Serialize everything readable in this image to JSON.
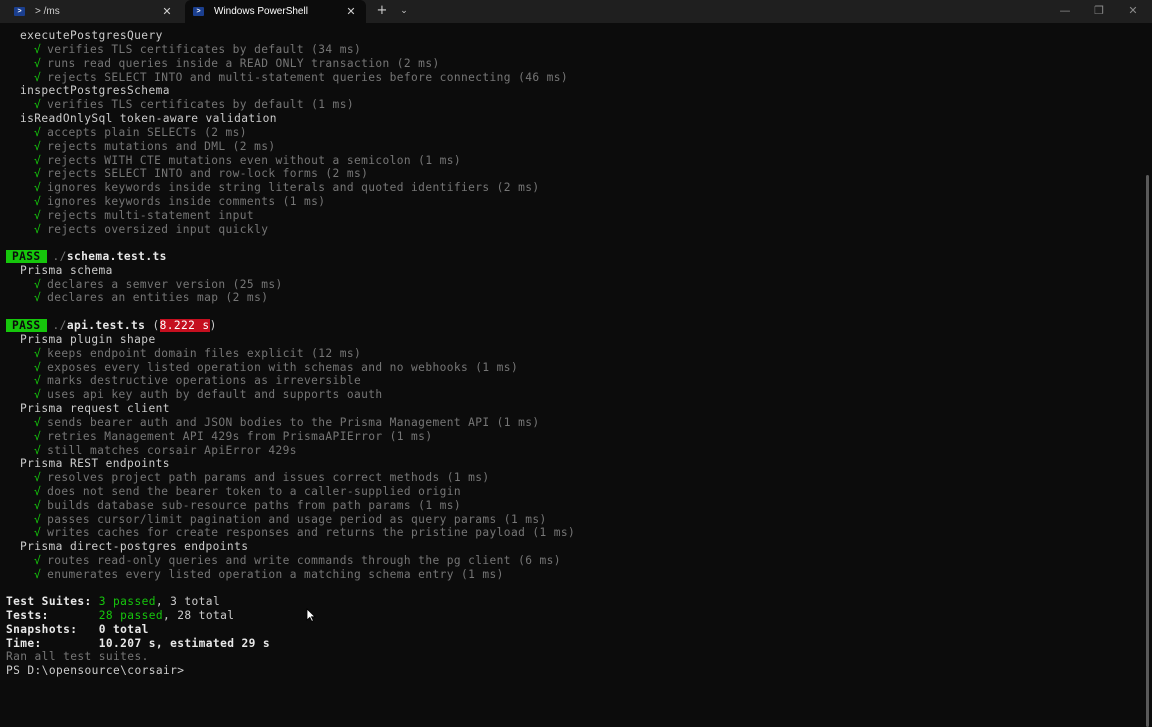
{
  "tabs": [
    {
      "label": "> /ms",
      "icon": "powershell-icon",
      "active": false
    },
    {
      "label": "Windows PowerShell",
      "icon": "powershell-icon",
      "active": true
    }
  ],
  "titlebar": {
    "new_tab": "+",
    "dropdown": "⌄",
    "minimize": "—",
    "maximize": "❐",
    "close": "✕",
    "tab_close": "✕"
  },
  "terminal": {
    "check": "√",
    "suite1": {
      "g1": "executePostgresQuery",
      "g1_items": [
        "verifies TLS certificates by default (34 ms)",
        "runs read queries inside a READ ONLY transaction (2 ms)",
        "rejects SELECT INTO and multi-statement queries before connecting (46 ms)"
      ],
      "g2": "inspectPostgresSchema",
      "g2_items": [
        "verifies TLS certificates by default (1 ms)"
      ],
      "g3": "isReadOnlySql token-aware validation",
      "g3_items": [
        "accepts plain SELECTs (2 ms)",
        "rejects mutations and DML (2 ms)",
        "rejects WITH CTE mutations even without a semicolon (1 ms)",
        "rejects SELECT INTO and row-lock forms (2 ms)",
        "ignores keywords inside string literals and quoted identifiers (2 ms)",
        "ignores keywords inside comments (1 ms)",
        "rejects multi-statement input",
        "rejects oversized input quickly"
      ]
    },
    "suite2": {
      "badge": "PASS",
      "dir": "./",
      "file": "schema.test.ts",
      "g1": "Prisma schema",
      "g1_items": [
        "declares a semver version (25 ms)",
        "declares an entities map (2 ms)"
      ]
    },
    "suite3": {
      "badge": "PASS",
      "dir": "./",
      "file": "api.test.ts",
      "paren_open": " (",
      "duration": "8.222 s",
      "paren_close": ")",
      "g1": "Prisma plugin shape",
      "g1_items": [
        "keeps endpoint domain files explicit (12 ms)",
        "exposes every listed operation with schemas and no webhooks (1 ms)",
        "marks destructive operations as irreversible",
        "uses api key auth by default and supports oauth"
      ],
      "g2": "Prisma request client",
      "g2_items": [
        "sends bearer auth and JSON bodies to the Prisma Management API (1 ms)",
        "retries Management API 429s from PrismaAPIError (1 ms)",
        "still matches corsair ApiError 429s"
      ],
      "g3": "Prisma REST endpoints",
      "g3_items": [
        "resolves project path params and issues correct methods (1 ms)",
        "does not send the bearer token to a caller-supplied origin",
        "builds database sub-resource paths from path params (1 ms)",
        "passes cursor/limit pagination and usage period as query params (1 ms)",
        "writes caches for create responses and returns the pristine payload (1 ms)"
      ],
      "g4": "Prisma direct-postgres endpoints",
      "g4_items": [
        "routes read-only queries and write commands through the pg client (6 ms)",
        "enumerates every listed operation a matching schema entry (1 ms)"
      ]
    },
    "summary": {
      "suites_label": "Test Suites: ",
      "suites_passed": "3 passed",
      "suites_rest": ", 3 total",
      "tests_label": "Tests:       ",
      "tests_passed": "28 passed",
      "tests_rest": ", 28 total",
      "snapshots": "Snapshots:   0 total",
      "time": "Time:        10.207 s, estimated 29 s",
      "ran": "Ran all test suites."
    },
    "prompt": "PS D:\\opensource\\corsair>"
  }
}
